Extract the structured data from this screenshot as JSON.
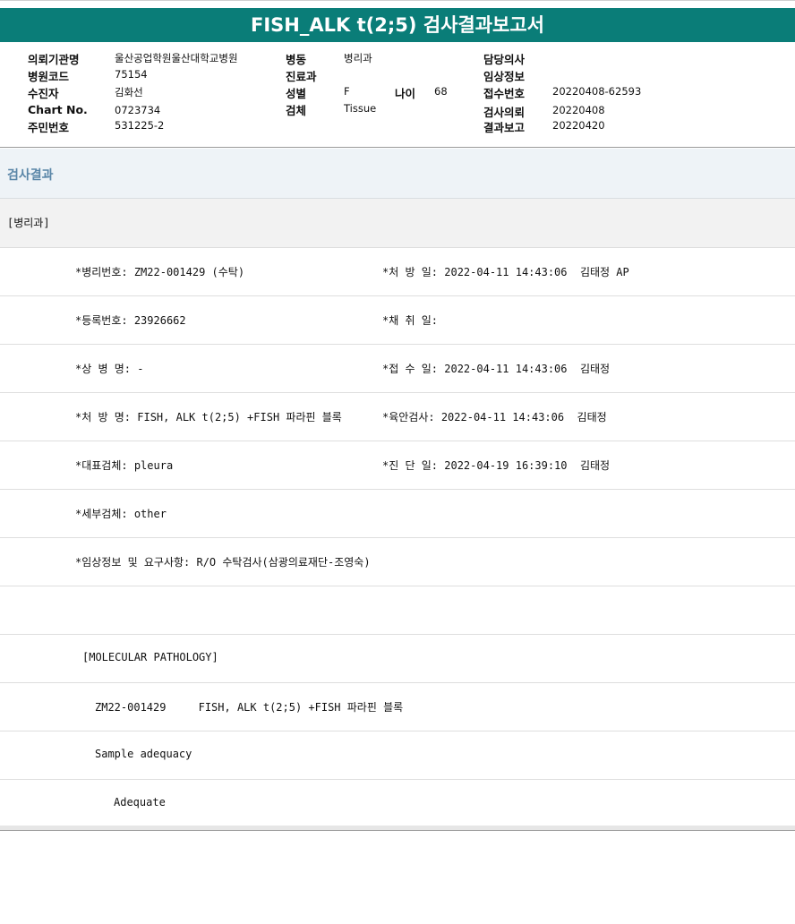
{
  "report": {
    "title": "FISH_ALK t(2;5) 검사결과보고서"
  },
  "header": {
    "institution_label": "의뢰기관명",
    "institution_value": "울산공업학원울산대학교병원",
    "hospital_code_label": "병원코드",
    "hospital_code_value": "75154",
    "patient_label": "수진자",
    "patient_value": "김화선",
    "chart_label": "Chart No.",
    "chart_value": "0723734",
    "resident_label": "주민번호",
    "resident_value": "531225-2",
    "ward_label": "병동",
    "ward_value": "병리과",
    "clinic_label": "진료과",
    "clinic_value": "",
    "sex_label": "성별",
    "sex_value": "F",
    "age_label": "나이",
    "age_value": "68",
    "specimen_label": "검체",
    "specimen_value": "Tissue",
    "doctor_label": "담당의사",
    "doctor_value": "",
    "clinical_label": "임상정보",
    "clinical_value": "",
    "receipt_label": "접수번호",
    "receipt_value": "20220408-62593",
    "request_label": "검사의뢰",
    "request_value": "20220408",
    "result_label": "결과보고",
    "result_value": "20220420"
  },
  "results": {
    "section_title": "검사결과",
    "department": "[병리과]",
    "rows": [
      {
        "left": "*병리번호: ZM22-001429 (수탁)",
        "right": "*처 방 일: 2022-04-11 14:43:06  김태정 AP"
      },
      {
        "left": "*등록번호: 23926662",
        "right": "*채 취 일:"
      },
      {
        "left": "*상 병 명: -",
        "right": "*접 수 일: 2022-04-11 14:43:06  김태정"
      },
      {
        "left": "*처 방 명: FISH, ALK t(2;5) +FISH 파라핀 블록",
        "right": "*육안검사: 2022-04-11 14:43:06  김태정"
      },
      {
        "left": "*대표검체: pleura",
        "right": "*진 단 일: 2022-04-19 16:39:10  김태정"
      },
      {
        "left": "*세부검체: other",
        "right": ""
      },
      {
        "left": "*임상정보 및 요구사항: R/O 수탁검사(삼광의료재단-조영숙)",
        "right": ""
      }
    ],
    "molecular_header": "[MOLECULAR PATHOLOGY]",
    "molecular_line": "ZM22-001429     FISH, ALK t(2;5) +FISH 파라핀 블록",
    "sample_adequacy_label": "Sample adequacy",
    "sample_adequacy_value": "Adequate"
  }
}
